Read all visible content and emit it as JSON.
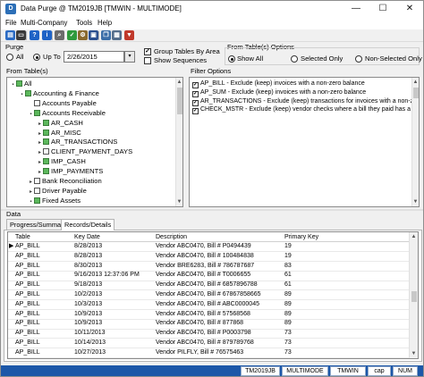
{
  "window": {
    "app_icon_letter": "D",
    "title": "Data Purge @ TM2019JB [TMWIN - MULTIMODE]",
    "minimize": "—",
    "maximize": "☐",
    "close": "✕"
  },
  "menu": [
    "File",
    "Multi-Company",
    "Tools",
    "Help"
  ],
  "toolbar": {
    "icons": [
      {
        "name": "purge-icon",
        "color": "#2b6bc4",
        "glyph": "▤"
      },
      {
        "name": "screen-icon",
        "color": "#3a3a3a",
        "glyph": "▭"
      },
      {
        "name": "help-icon",
        "color": "#1f63c6",
        "glyph": "?"
      },
      {
        "name": "info-icon",
        "color": "#1f63c6",
        "glyph": "i"
      },
      {
        "name": "search-icon",
        "color": "#6c6c6c",
        "glyph": "⌕"
      },
      {
        "name": "check-icon",
        "color": "#2f9a3c",
        "glyph": "✓"
      },
      {
        "name": "gear-icon",
        "color": "#8a6a2e",
        "glyph": "⚙"
      },
      {
        "name": "save-icon",
        "color": "#2b4f8f",
        "glyph": "▣"
      },
      {
        "name": "copy-icon",
        "color": "#3b6ea8",
        "glyph": "❐"
      },
      {
        "name": "report-icon",
        "color": "#546e8c",
        "glyph": "▦"
      },
      {
        "name": "filter-icon",
        "color": "#c0392b",
        "glyph": "▼"
      }
    ]
  },
  "purge": {
    "label": "Purge",
    "all": "All",
    "upto": "Up To",
    "date": "2/26/2015",
    "group_tables": "Group Tables By Area",
    "show_sequences": "Show Sequences"
  },
  "from_options": {
    "label": "From Table(s) Options",
    "show_all": "Show All",
    "selected_only": "Selected Only",
    "non_selected_only": "Non-Selected Only"
  },
  "from_tables": {
    "label": "From Table(s)",
    "rows": [
      {
        "level": 0,
        "twisty": "▪",
        "text": "All",
        "checked": true
      },
      {
        "level": 1,
        "twisty": "▪",
        "text": "Accounting & Finance",
        "checked": true
      },
      {
        "level": 2,
        "twisty": "",
        "text": "Accounts Payable",
        "checked": false
      },
      {
        "level": 2,
        "twisty": "▪",
        "text": "Accounts Receivable",
        "checked": true
      },
      {
        "level": 3,
        "twisty": "▸",
        "text": "AR_CASH",
        "checked": true
      },
      {
        "level": 3,
        "twisty": "▸",
        "text": "AR_MISC",
        "checked": true
      },
      {
        "level": 3,
        "twisty": "▸",
        "text": "AR_TRANSACTIONS",
        "checked": true
      },
      {
        "level": 3,
        "twisty": "▸",
        "text": "CLIENT_PAYMENT_DAYS",
        "checked": false
      },
      {
        "level": 3,
        "twisty": "▸",
        "text": "IMP_CASH",
        "checked": true
      },
      {
        "level": 3,
        "twisty": "▸",
        "text": "IMP_PAYMENTS",
        "checked": true
      },
      {
        "level": 2,
        "twisty": "▸",
        "text": "Bank Reconciliation",
        "checked": false
      },
      {
        "level": 2,
        "twisty": "▸",
        "text": "Driver Payable",
        "checked": false
      },
      {
        "level": 2,
        "twisty": "▪",
        "text": "Fixed Assets",
        "checked": true
      }
    ]
  },
  "filter_options": {
    "label": "Filter Options",
    "items": [
      "AP_BILL - Exclude (keep) invoices with a non-zero balance",
      "AP_SUM - Exclude (keep) invoices with a non-zero balance",
      "AR_TRANSACTIONS - Exclude (keep) transactions for invoices with a non-zero balance",
      "CHECK_MSTR - Exclude (keep) vendor checks where a bill they paid has a non-zero balance"
    ]
  },
  "data": {
    "label": "Data",
    "tabs": [
      "Progress/Summary",
      "Records/Details"
    ],
    "active_tab": 1,
    "columns": [
      "Table",
      "Key Date",
      "Description",
      "Primary Key"
    ],
    "rows": [
      [
        "AP_BILL",
        "8/28/2013",
        "Vendor ABC0470, Bill # P0494439",
        "19"
      ],
      [
        "AP_BILL",
        "8/28/2013",
        "Vendor ABC0470, Bill # 100484838",
        "19"
      ],
      [
        "AP_BILL",
        "8/30/2013",
        "Vendor BRE6283, Bill # 786787687",
        "83"
      ],
      [
        "AP_BILL",
        "9/16/2013 12:37:06 PM",
        "Vendor ABC0470, Bill # T0006655",
        "61"
      ],
      [
        "AP_BILL",
        "9/18/2013",
        "Vendor ABC0470, Bill # 6857896788",
        "61"
      ],
      [
        "AP_BILL",
        "10/2/2013",
        "Vendor ABC0470, Bill # 67867858665",
        "89"
      ],
      [
        "AP_BILL",
        "10/3/2013",
        "Vendor ABC0470, Bill # ABC0000045",
        "89"
      ],
      [
        "AP_BILL",
        "10/9/2013",
        "Vendor ABC0470, Bill # 57568568",
        "89"
      ],
      [
        "AP_BILL",
        "10/9/2013",
        "Vendor ABC0470, Bill # 877868",
        "89"
      ],
      [
        "AP_BILL",
        "10/11/2013",
        "Vendor ABC0470, Bill # P0003798",
        "73"
      ],
      [
        "AP_BILL",
        "10/14/2013",
        "Vendor ABC0470, Bill # 879789768",
        "73"
      ],
      [
        "AP_BILL",
        "10/27/2013",
        "Vendor PILFLY, Bill # 76575463",
        "73"
      ]
    ]
  },
  "status": {
    "segments": [
      "TM2019JB",
      "MULTIMODE",
      "TMWIN",
      "cap",
      "NUM"
    ]
  }
}
